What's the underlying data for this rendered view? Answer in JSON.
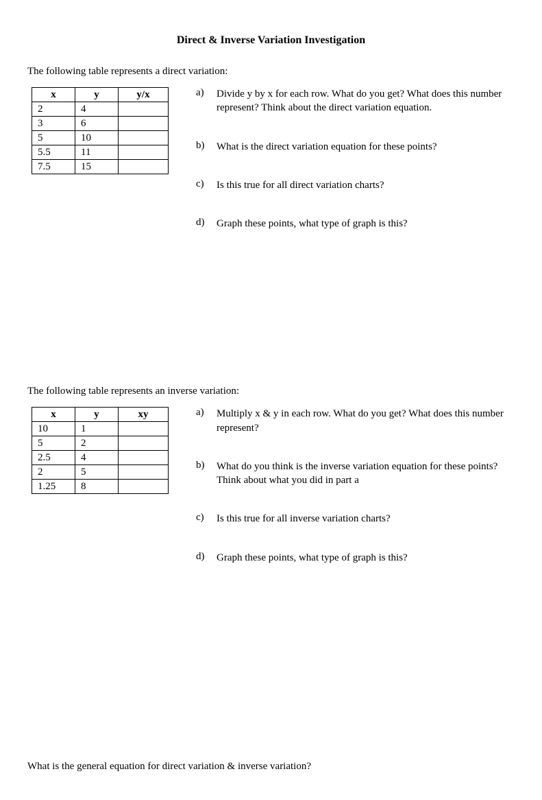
{
  "title": "Direct & Inverse Variation Investigation",
  "section1": {
    "intro": "The following table represents a direct variation:",
    "headers": {
      "c1": "x",
      "c2": "y",
      "c3": "y/x"
    },
    "rows": [
      {
        "c1": "2",
        "c2": "4",
        "c3": ""
      },
      {
        "c1": "3",
        "c2": "6",
        "c3": ""
      },
      {
        "c1": "5",
        "c2": "10",
        "c3": ""
      },
      {
        "c1": "5.5",
        "c2": "11",
        "c3": ""
      },
      {
        "c1": "7.5",
        "c2": "15",
        "c3": ""
      }
    ],
    "questions": {
      "a": {
        "label": "a)",
        "text": "Divide y by x for each row. What do you get? What does this number represent? Think about the direct variation equation."
      },
      "b": {
        "label": "b)",
        "text": "What is the direct variation equation for these points?"
      },
      "c": {
        "label": "c)",
        "text": "Is this true for all direct variation charts?"
      },
      "d": {
        "label": "d)",
        "text": "Graph these points, what type of graph is this?"
      }
    }
  },
  "section2": {
    "intro": "The following table represents an inverse variation:",
    "headers": {
      "c1": "x",
      "c2": "y",
      "c3": "xy"
    },
    "rows": [
      {
        "c1": "10",
        "c2": "1",
        "c3": ""
      },
      {
        "c1": "5",
        "c2": "2",
        "c3": ""
      },
      {
        "c1": "2.5",
        "c2": "4",
        "c3": ""
      },
      {
        "c1": "2",
        "c2": "5",
        "c3": ""
      },
      {
        "c1": "1.25",
        "c2": "8",
        "c3": ""
      }
    ],
    "questions": {
      "a": {
        "label": "a)",
        "text": "Multiply x & y in each row. What do you get? What does this number represent?"
      },
      "b": {
        "label": "b)",
        "text": "What do you think is the inverse variation equation for these points? Think about what you did in part a"
      },
      "c": {
        "label": "c)",
        "text": "Is this true for all inverse variation charts?"
      },
      "d": {
        "label": "d)",
        "text": "Graph these points, what type of graph is this?"
      }
    }
  },
  "final": "What is the general equation for direct variation & inverse variation?"
}
